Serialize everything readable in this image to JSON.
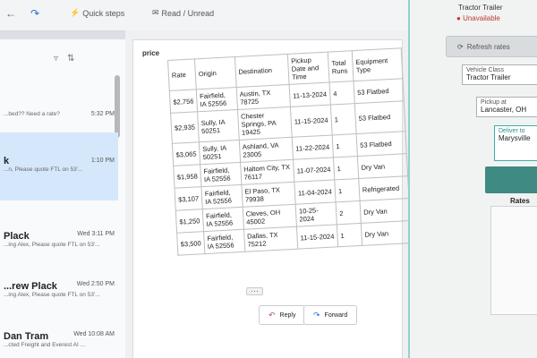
{
  "toolbar": {
    "quick_steps": "Quick steps",
    "read_unread": "Read / Unread"
  },
  "message_list": {
    "items": [
      {
        "name": "",
        "time": "5:32 PM",
        "snippet": "...bed?? Need a rate?"
      },
      {
        "name": "k",
        "time": "1:10 PM",
        "snippet": "...n, Please quote FTL on 53'..."
      },
      {
        "name": "Plack",
        "time": "Wed 3:11 PM",
        "snippet": "...ing Alex, Please quote FTL on 53'..."
      },
      {
        "name": "...rew Plack",
        "time": "Wed 2:50 PM",
        "snippet": "...ing Alex, Please quote FTL on 53'..."
      },
      {
        "name": "Dan Tram",
        "time": "Wed 10:08 AM",
        "snippet": "...cted Freight and Everest AI ..."
      }
    ]
  },
  "email": {
    "subject_fragment": "price",
    "table": {
      "headers": [
        "Rate",
        "Origin",
        "Destination",
        "Pickup Date and Time",
        "Total Runs",
        "Equipment Type"
      ],
      "rows": [
        [
          "$2,756",
          "Fairfield, IA 52556",
          "Austin, TX 78725",
          "11-13-2024",
          "4",
          "53 Flatbed"
        ],
        [
          "$2,935",
          "Sully, IA 50251",
          "Chester Springs, PA 19425",
          "11-15-2024",
          "1",
          "53 Flatbed"
        ],
        [
          "$3,065",
          "Sully, IA 50251",
          "Ashland, VA 23005",
          "11-22-2024",
          "1",
          "53 Flatbed"
        ],
        [
          "$1,958",
          "Fairfield, IA 52556",
          "Haltom City, TX 76117",
          "11-07-2024",
          "1",
          "Dry Van"
        ],
        [
          "$3,107",
          "Fairfield, IA 52556",
          "El Paso, TX 79938",
          "11-04-2024",
          "1",
          "Refrigerated"
        ],
        [
          "$1,250",
          "Fairfield, IA 52556",
          "Cleves, OH 45002",
          "10-25-2024",
          "2",
          "Dry Van"
        ],
        [
          "$3,500",
          "Fairfield, IA 52556",
          "Dallas, TX 75212",
          "11-15-2024",
          "1",
          "Dry Van"
        ]
      ]
    },
    "reply_label": "Reply",
    "forward_label": "Forward"
  },
  "side_panel": {
    "header": "Tractor Trailer",
    "status": "Unavailable",
    "refresh_label": "Refresh rates",
    "vehicle_class_label": "Vehicle Class",
    "vehicle_class_value": "Tractor Trailer",
    "pickup_label": "Pickup at",
    "pickup_value": "Lancaster, OH",
    "deliver_label": "Deliver to",
    "deliver_value": "Marysville",
    "rates_label": "Rates"
  },
  "colors": {
    "accent": "#2a6fd6",
    "teal": "#3f8a82",
    "selected_row": "#d5e8fb",
    "unavailable": "#c0392b"
  }
}
